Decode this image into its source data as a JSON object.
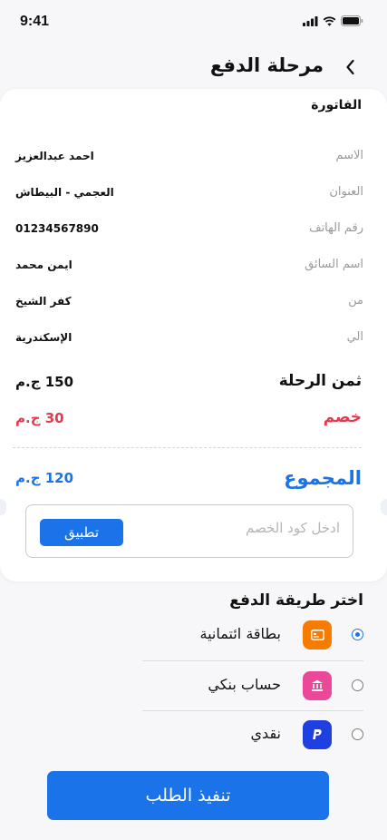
{
  "status_bar": {
    "time": "9:41"
  },
  "header": {
    "title": "مرحلة الدفع"
  },
  "invoice": {
    "title": "الفاتورة",
    "rows": [
      {
        "label": "الاسم",
        "value": "احمد عبدالعزيز"
      },
      {
        "label": "العنوان",
        "value": "العجمي - البيطاش"
      },
      {
        "label": "رقم الهاتف",
        "value": "01234567890"
      },
      {
        "label": "اسم السائق",
        "value": "ايمن محمد"
      },
      {
        "label": "من",
        "value": "كفر الشيخ"
      },
      {
        "label": "الي",
        "value": "الإسكندرية"
      }
    ],
    "fare": {
      "label": "ثمن الرحلة",
      "value": "150 ج.م"
    },
    "discount": {
      "label": "خصم",
      "value": "30 ج.م"
    },
    "total": {
      "label": "المجموع",
      "value": "120 ج.م"
    },
    "coupon": {
      "placeholder": "ادخل كود الخصم",
      "value": "",
      "apply_label": "تطبيق"
    }
  },
  "payment": {
    "title": "اختر طريقة الدفع",
    "methods": [
      {
        "label": "بطاقة ائتمانية",
        "icon": "credit-card-icon",
        "color": "#f57c00",
        "selected": true
      },
      {
        "label": "حساب بنكي",
        "icon": "bank-icon",
        "color": "#ec4899",
        "selected": false
      },
      {
        "label": "نقدي",
        "icon": "paypal-icon",
        "color": "#1e40e0",
        "selected": false
      }
    ]
  },
  "submit_label": "تنفيذ الطلب",
  "colors": {
    "accent": "#1a73e8",
    "discount": "#e53950",
    "total": "#1a73e8"
  }
}
